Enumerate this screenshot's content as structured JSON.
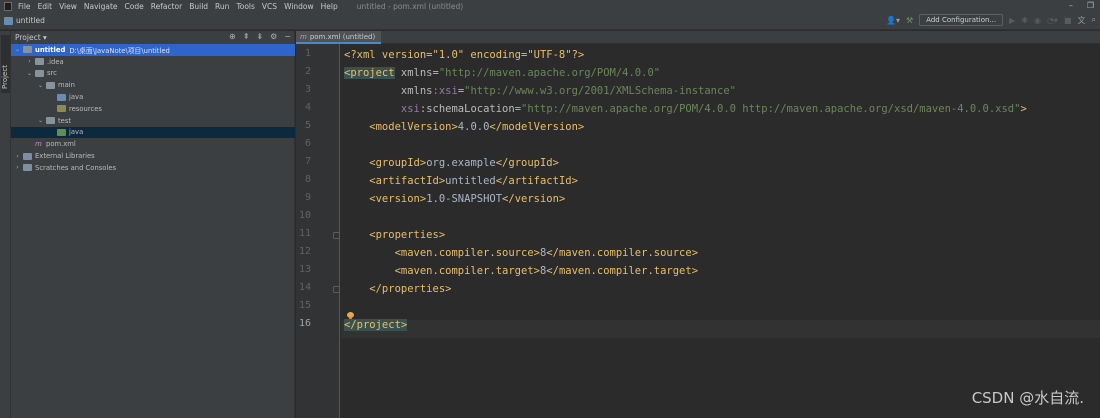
{
  "menubar": {
    "items": [
      "File",
      "Edit",
      "View",
      "Navigate",
      "Code",
      "Refactor",
      "Build",
      "Run",
      "Tools",
      "VCS",
      "Window",
      "Help"
    ],
    "window_title": "untitled - pom.xml (untitled)"
  },
  "navbar": {
    "project_name": "untitled",
    "run_config_label": "Add Configuration..."
  },
  "sidebar": {
    "tab_label": "Project"
  },
  "project_panel": {
    "title": "Project",
    "tree": [
      {
        "label": "untitled",
        "path": "D:\\桌面\\JavaNote\\项目\\untitled"
      },
      {
        "label": ".idea"
      },
      {
        "label": "src"
      },
      {
        "label": "main"
      },
      {
        "label": "java"
      },
      {
        "label": "resources"
      },
      {
        "label": "test"
      },
      {
        "label": "java"
      },
      {
        "label": "pom.xml"
      },
      {
        "label": "External Libraries"
      },
      {
        "label": "Scratches and Consoles"
      }
    ]
  },
  "editor": {
    "tab_label": "pom.xml (untitled)",
    "line_numbers": [
      "1",
      "2",
      "3",
      "4",
      "5",
      "6",
      "7",
      "8",
      "9",
      "10",
      "11",
      "12",
      "13",
      "14",
      "15",
      "16"
    ],
    "lines": {
      "l1": {
        "decl": "<?xml version=\"1.0\" encoding=\"UTF-8\"?>"
      },
      "l2": {
        "open": "<project",
        "attr": " xmlns=",
        "val": "\"http://maven.apache.org/POM/4.0.0\""
      },
      "l3": {
        "pre": "         xmlns",
        "ns": ":xsi",
        "eq": "=",
        "val": "\"http://www.w3.org/2001/XMLSchema-instance\""
      },
      "l4": {
        "pre": "         ",
        "ns": "xsi",
        "attr": ":schemaLocation=",
        "val": "\"http://maven.apache.org/POM/4.0.0 http://maven.apache.org/xsd/maven-4.0.0.xsd\"",
        "close": ">"
      },
      "l5": {
        "open": "    <modelVersion>",
        "text": "4.0.0",
        "close": "</modelVersion>"
      },
      "l7": {
        "open": "    <groupId>",
        "text": "org.example",
        "close": "</groupId>"
      },
      "l8": {
        "open": "    <artifactId>",
        "text": "untitled",
        "close": "</artifactId>"
      },
      "l9": {
        "open": "    <version>",
        "text": "1.0-SNAPSHOT",
        "close": "</version>"
      },
      "l11": {
        "open": "    <properties>"
      },
      "l12": {
        "open": "        <maven.compiler.source>",
        "text": "8",
        "close": "</maven.compiler.source>"
      },
      "l13": {
        "open": "        <maven.compiler.target>",
        "text": "8",
        "close": "</maven.compiler.target>"
      },
      "l14": {
        "close": "    </properties>"
      },
      "l16": {
        "close": "</project>"
      }
    }
  },
  "watermark": "CSDN @水自流."
}
